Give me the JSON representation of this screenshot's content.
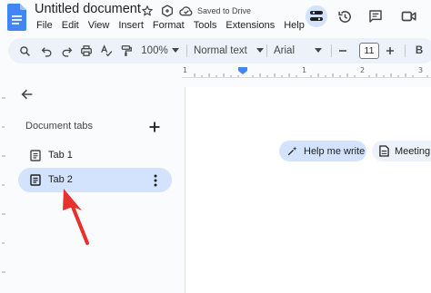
{
  "header": {
    "title": "Untitled document",
    "saved_status": "Saved to Drive",
    "menu": [
      "File",
      "Edit",
      "View",
      "Insert",
      "Format",
      "Tools",
      "Extensions",
      "Help"
    ]
  },
  "toolbar": {
    "zoom": "100%",
    "style": "Normal text",
    "font": "Arial",
    "font_size": "11"
  },
  "ruler": {
    "labels": [
      "1",
      "1",
      "2",
      "3"
    ]
  },
  "sidebar": {
    "heading": "Document tabs",
    "tabs": [
      {
        "label": "Tab 1",
        "selected": false
      },
      {
        "label": "Tab 2",
        "selected": true
      }
    ]
  },
  "chips": {
    "help": "Help me write",
    "meeting": "Meeting"
  },
  "colors": {
    "accent": "#d3e3fd",
    "arrow": "#e8302c",
    "docs_blue": "#4285f4"
  }
}
